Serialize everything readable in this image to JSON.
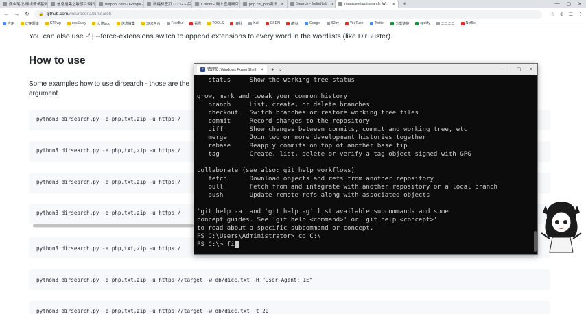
{
  "browser": {
    "tabs": [
      {
        "label": "爬虫笔记-网络请求基础"
      },
      {
        "label": "信息搜集之敏感目录扫描"
      },
      {
        "label": "mappoi.com - Google 搜索"
      },
      {
        "label": "新建标签页 - LCG + 后端字"
      },
      {
        "label": "ChromE 网上应用商店"
      },
      {
        "label": "php.cnl_php资讯"
      },
      {
        "label": "Search - fratiet7ab"
      },
      {
        "label": "maurosoria/dirsearch: W...",
        "active": true
      }
    ],
    "new_tab": "+",
    "window_controls": [
      "—",
      "▢",
      "✕"
    ],
    "back": "←",
    "forward": "→",
    "reload": "↻",
    "url_host": "github.com",
    "url_path": "/maurosoria/dirsearch",
    "lock": "🔒",
    "toolbar_icons": [
      "☆",
      "⊕",
      "☰",
      "⋮"
    ],
    "bookmarks": [
      {
        "label": "应用",
        "color": "blue"
      },
      {
        "label": "CTF题库",
        "color": "yellow"
      },
      {
        "label": "CTFwp",
        "color": "yellow"
      },
      {
        "label": "secStudy",
        "color": "yellow"
      },
      {
        "label": "大佬blog",
        "color": "yellow"
      },
      {
        "label": "信息收集",
        "color": "yellow"
      },
      {
        "label": "SRC平台",
        "color": "yellow"
      },
      {
        "label": "FreeBuf",
        "color": "gray"
      },
      {
        "label": "看雪",
        "color": "red"
      },
      {
        "label": "TOOLS",
        "color": "yellow"
      },
      {
        "label": "i春秋",
        "color": "red"
      },
      {
        "label": "Kali",
        "color": "gray"
      },
      {
        "label": "CSDN",
        "color": "red"
      },
      {
        "label": "i春秋",
        "color": "red"
      },
      {
        "label": "Google",
        "color": "blue"
      },
      {
        "label": "52py",
        "color": "gray"
      },
      {
        "label": "YouTube",
        "color": "red"
      },
      {
        "label": "Twitter",
        "color": "blue"
      },
      {
        "label": "分享链接",
        "color": "green"
      },
      {
        "label": "spotify",
        "color": "green"
      },
      {
        "label": "ニコニコ",
        "color": "gray"
      },
      {
        "label": "Netflix",
        "color": "red"
      }
    ]
  },
  "content": {
    "para1": "You can also use -f | --force-extensions switch to append extensions to every word in the wordlists (like DirBuster).",
    "heading": "How to use",
    "para2": "Some examples how to use dirsearch - those are the argument.",
    "code_lines": [
      "python3 dirsearch.py -e php,txt,zip -u https:/",
      "python3 dirsearch.py -e php,txt,zip -u https:/",
      "python3 dirsearch.py -e php,txt,zip -u https:/",
      "python3 dirsearch.py -e php,txt,zip -u https:/",
      "python3 dirsearch.py -e php,txt,zip -u https:/",
      "python3 dirsearch.py -e php,txt,zip -u https://target -w db/dicc.txt -H \"User-Agent: IE\"",
      "python3 dirsearch.py -e php,txt,zip -u https://target -w db/dicc.txt -t 20"
    ]
  },
  "powershell": {
    "tab_title": "管理员: Windows PowerShell",
    "tab_close": "✕",
    "new_tab": "+",
    "dropdown": "⌄",
    "window_controls": [
      "—",
      "▢",
      "✕"
    ],
    "lines": [
      "   status     Show the working tree status",
      "",
      "grow, mark and tweak your common history",
      "   branch     List, create, or delete branches",
      "   checkout   Switch branches or restore working tree files",
      "   commit     Record changes to the repository",
      "   diff       Show changes between commits, commit and working tree, etc",
      "   merge      Join two or more development histories together",
      "   rebase     Reapply commits on top of another base tip",
      "   tag        Create, list, delete or verify a tag object signed with GPG",
      "",
      "collaborate (see also: git help workflows)",
      "   fetch      Download objects and refs from another repository",
      "   pull       Fetch from and integrate with another repository or a local branch",
      "   push       Update remote refs along with associated objects",
      "",
      "'git help -a' and 'git help -g' list available subcommands and some",
      "concept guides. See 'git help <command>' or 'git help <concept>'",
      "to read about a specific subcommand or concept.",
      "PS C:\\Users\\Administrator> cd C:\\"
    ],
    "prompt_line": "PS C:\\> fi"
  }
}
